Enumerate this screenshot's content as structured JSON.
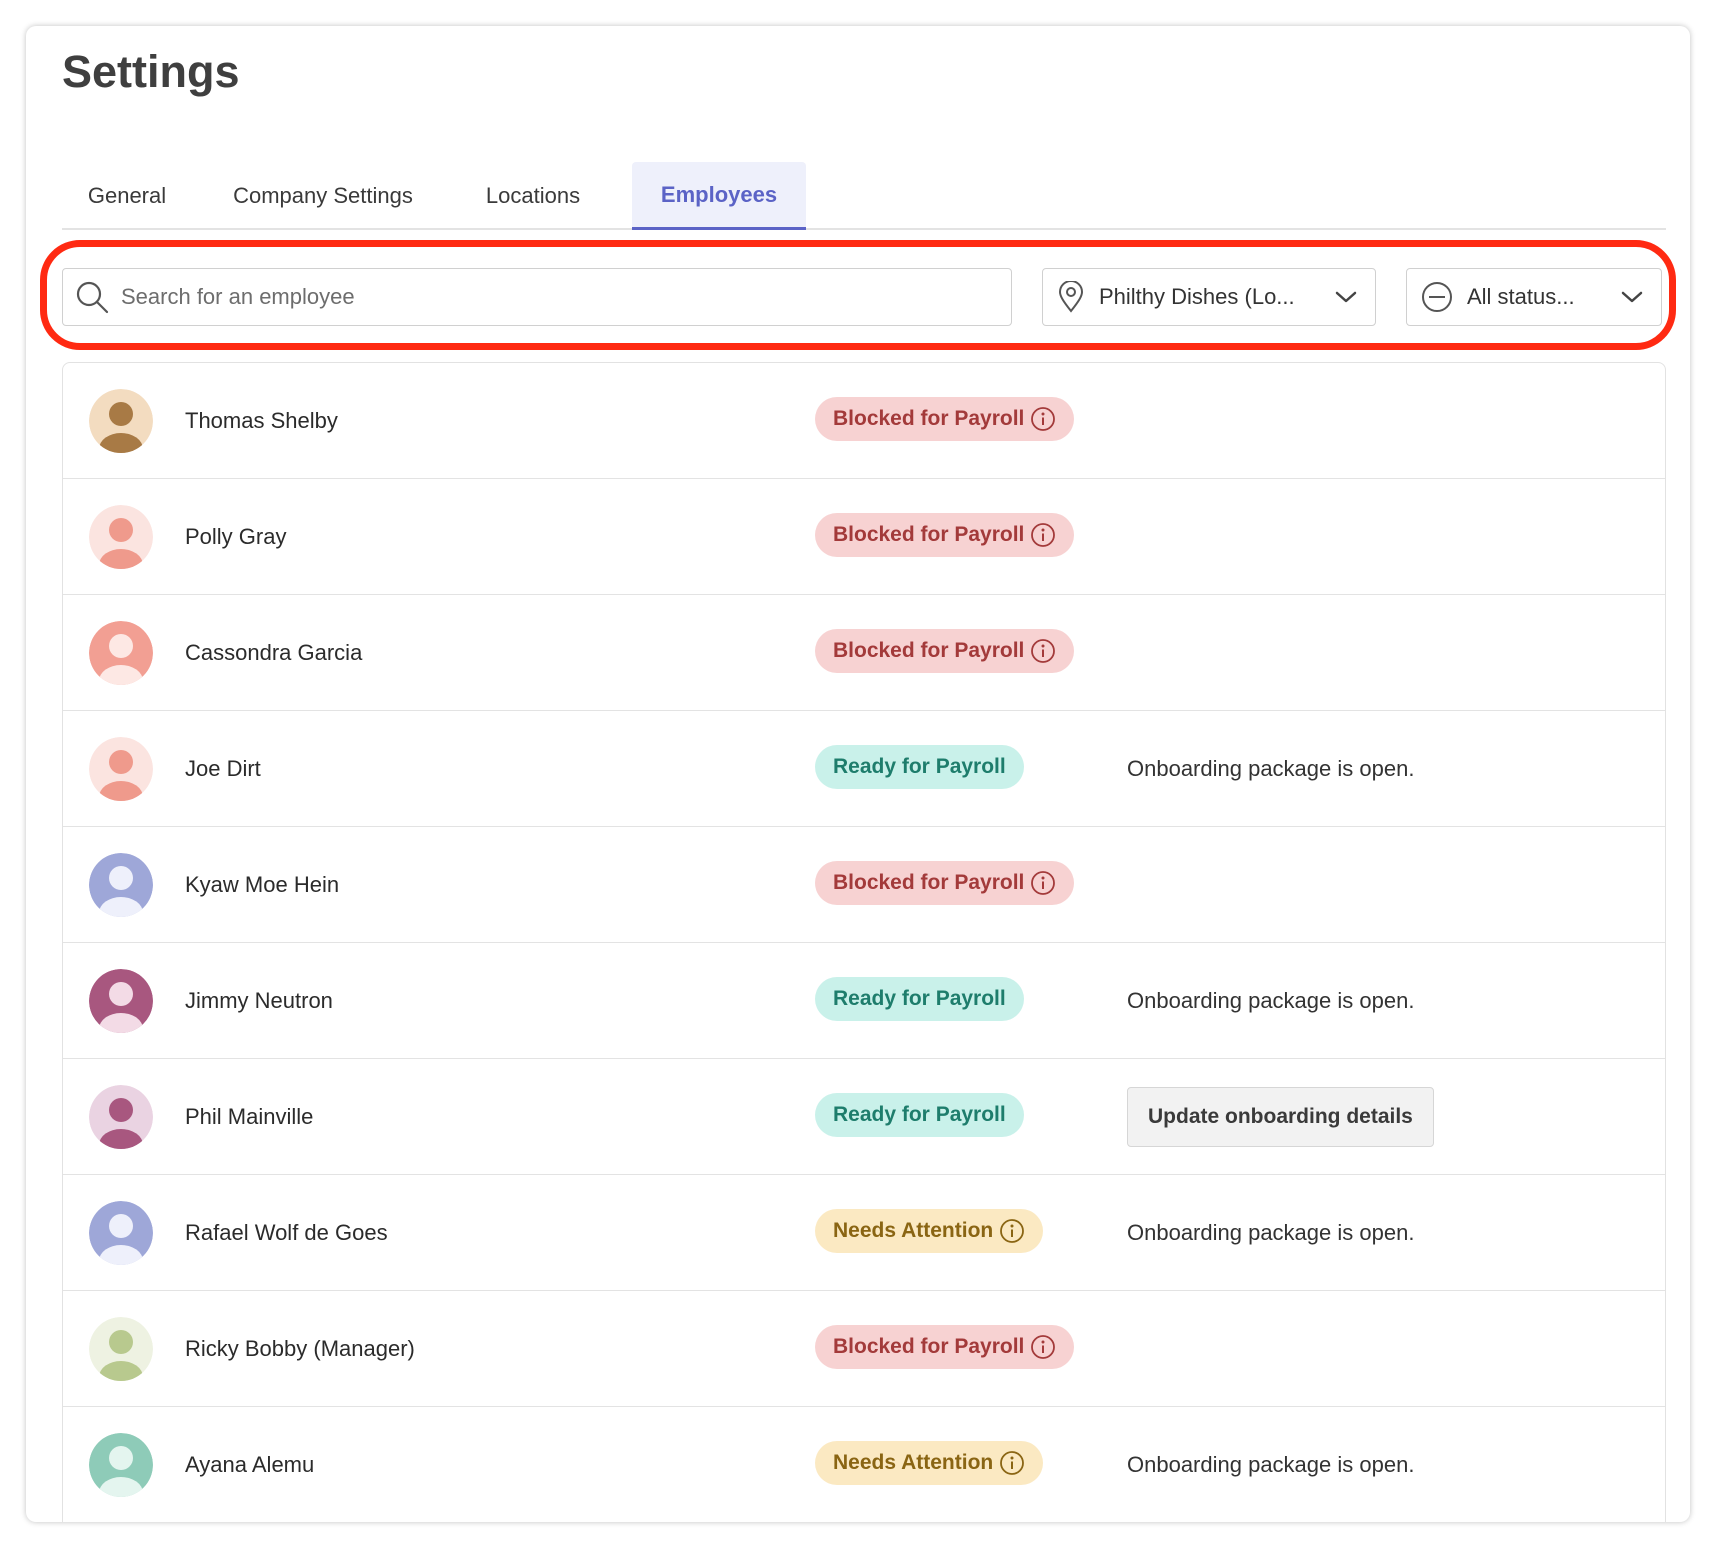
{
  "page": {
    "title": "Settings"
  },
  "tabs": [
    {
      "label": "General",
      "active": false
    },
    {
      "label": "Company Settings",
      "active": false
    },
    {
      "label": "Locations",
      "active": false
    },
    {
      "label": "Employees",
      "active": true
    }
  ],
  "filters": {
    "search_placeholder": "Search for an employee",
    "search_value": "",
    "location_value": "Philthy Dishes (Lo...",
    "status_value": "All status..."
  },
  "colors": {
    "accent": "#5b63c6",
    "highlight": "#ff2a12",
    "blocked_bg": "#f7d2d2",
    "blocked_text": "#a33a3a",
    "ready_bg": "#c9f1ea",
    "ready_text": "#1e7d6c",
    "attention_bg": "#fbe9c2",
    "attention_text": "#8a6513"
  },
  "employees": [
    {
      "name": "Thomas Shelby",
      "status": "Blocked for Payroll",
      "status_type": "blocked",
      "has_info": true,
      "note": "",
      "action": "",
      "avatar_bg": "#f3dcc0",
      "avatar_fg": "#a87a45"
    },
    {
      "name": "Polly Gray",
      "status": "Blocked for Payroll",
      "status_type": "blocked",
      "has_info": true,
      "note": "",
      "action": "",
      "avatar_bg": "#fbe4e0",
      "avatar_fg": "#ef9a8c"
    },
    {
      "name": "Cassondra Garcia",
      "status": "Blocked for Payroll",
      "status_type": "blocked",
      "has_info": true,
      "note": "",
      "action": "",
      "avatar_bg": "#f29f93",
      "avatar_fg": "#fde8e4"
    },
    {
      "name": "Joe Dirt",
      "status": "Ready for Payroll",
      "status_type": "ready",
      "has_info": false,
      "note": "Onboarding package is open.",
      "action": "",
      "avatar_bg": "#fbe4e0",
      "avatar_fg": "#ef9a8c"
    },
    {
      "name": "Kyaw Moe Hein",
      "status": "Blocked for Payroll",
      "status_type": "blocked",
      "has_info": true,
      "note": "",
      "action": "",
      "avatar_bg": "#9ea7d8",
      "avatar_fg": "#eef0fb"
    },
    {
      "name": "Jimmy Neutron",
      "status": "Ready for Payroll",
      "status_type": "ready",
      "has_info": false,
      "note": "Onboarding package is open.",
      "action": "",
      "avatar_bg": "#a8577f",
      "avatar_fg": "#f3dbe6"
    },
    {
      "name": "Phil Mainville",
      "status": "Ready for Payroll",
      "status_type": "ready",
      "has_info": false,
      "note": "",
      "action": "Update onboarding details",
      "avatar_bg": "#ead3e2",
      "avatar_fg": "#a8577f"
    },
    {
      "name": "Rafael Wolf de Goes",
      "status": "Needs Attention",
      "status_type": "attention",
      "has_info": true,
      "note": "Onboarding package is open.",
      "action": "",
      "avatar_bg": "#9ea7d8",
      "avatar_fg": "#eef0fb"
    },
    {
      "name": "Ricky Bobby (Manager)",
      "status": "Blocked for Payroll",
      "status_type": "blocked",
      "has_info": true,
      "note": "",
      "action": "",
      "avatar_bg": "#eef2e2",
      "avatar_fg": "#b8c98e"
    },
    {
      "name": "Ayana Alemu",
      "status": "Needs Attention",
      "status_type": "attention",
      "has_info": true,
      "note": "Onboarding package is open.",
      "action": "",
      "avatar_bg": "#8ecbb8",
      "avatar_fg": "#e4f5ef"
    }
  ]
}
